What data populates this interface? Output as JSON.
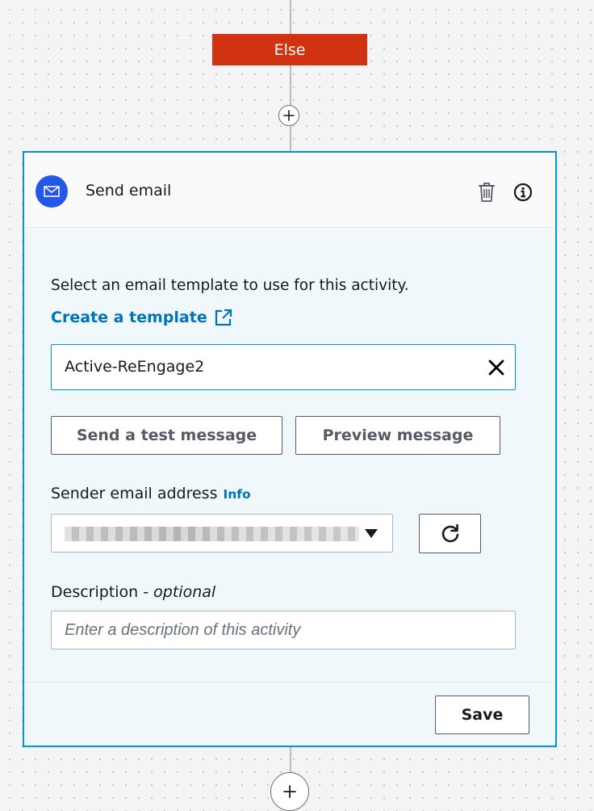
{
  "branch": {
    "label": "Else",
    "color": "#d13212"
  },
  "activity": {
    "title": "Send email",
    "accent_color": "#0096d6",
    "icon_color": "#2457e6",
    "instruction": "Select an email template to use for this activity.",
    "create_template_link": "Create a template",
    "template_value": "Active-ReEngage2",
    "send_test_label": "Send a test message",
    "preview_label": "Preview message",
    "sender_label": "Sender email address",
    "sender_info_link": "Info",
    "description_label": "Description -",
    "description_optional": "optional",
    "description_placeholder": "Enter a description of this activity",
    "save_label": "Save"
  },
  "icons": {
    "header": "mail-icon",
    "delete": "trash-icon",
    "info": "info-icon",
    "external": "external-link-icon",
    "clear": "close-icon",
    "dropdown": "caret-down-icon",
    "refresh": "refresh-icon",
    "add": "plus-icon"
  }
}
